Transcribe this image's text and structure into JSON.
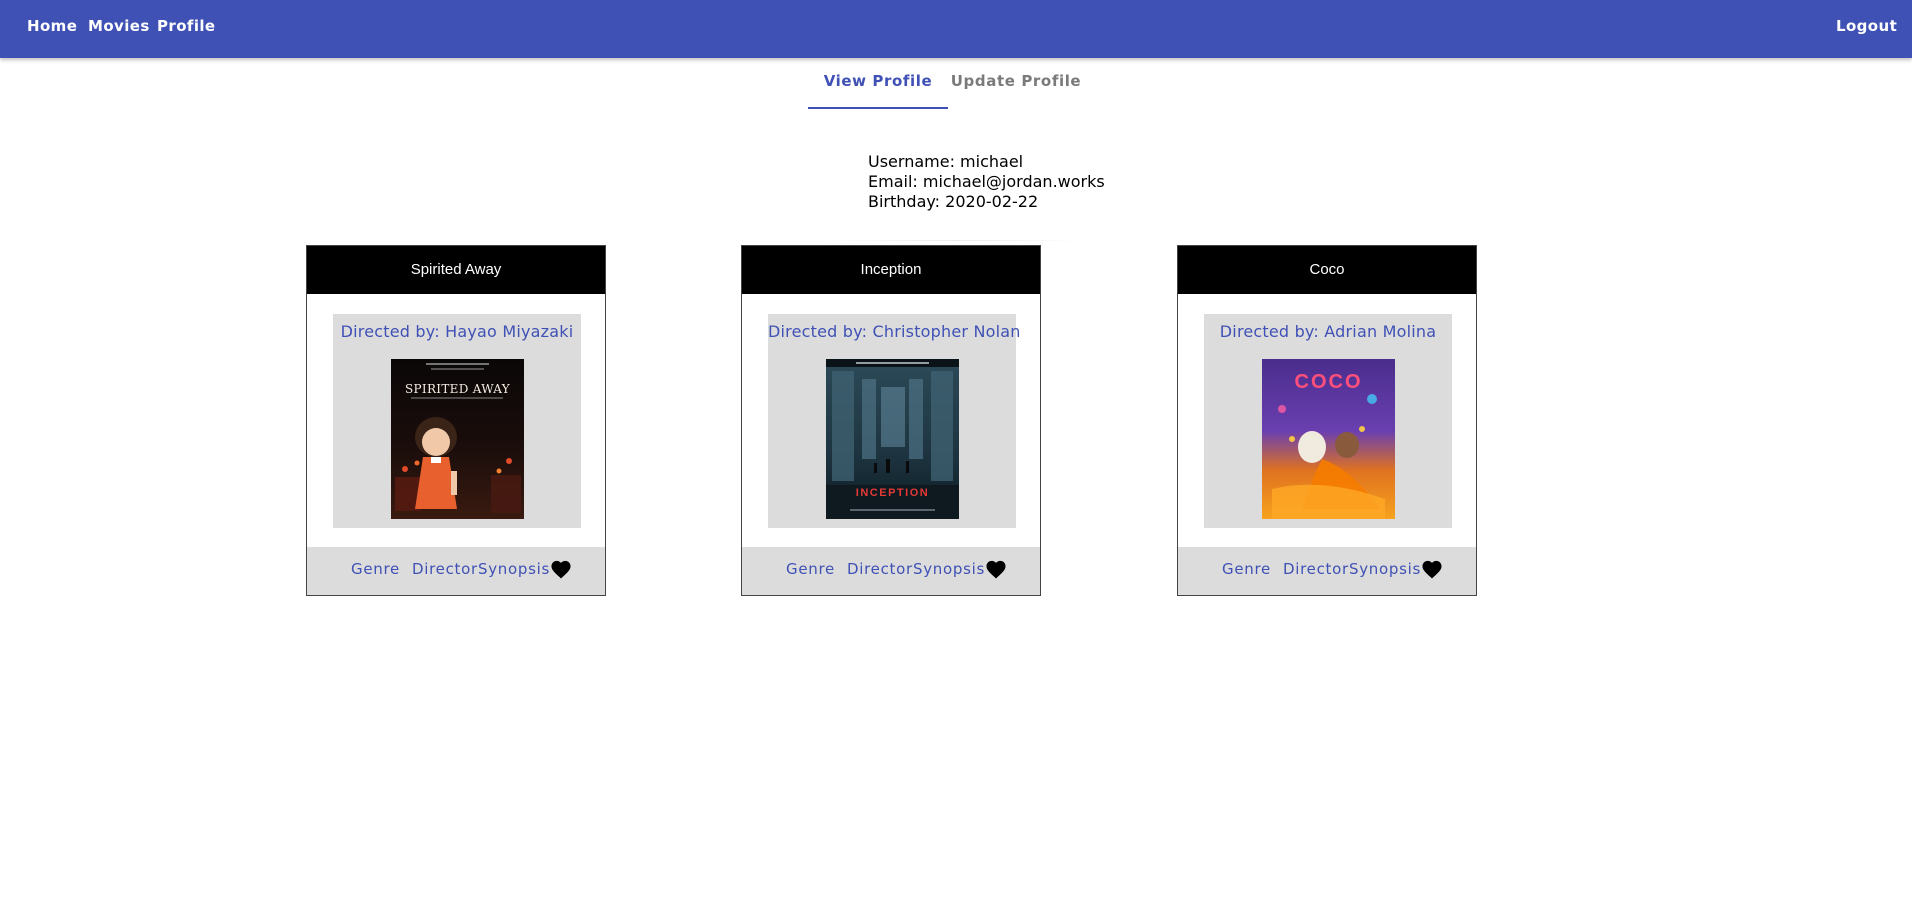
{
  "nav": {
    "home": "Home",
    "movies": "Movies",
    "profile": "Profile",
    "logout": "Logout"
  },
  "tabs": {
    "view": "View Profile",
    "update": "Update Profile"
  },
  "profile": {
    "username": "Username: michael",
    "email": "Email: michael@jordan.works",
    "birthday": "Birthday: 2020-02-22"
  },
  "movies": [
    {
      "title": "Spirited Away",
      "director": "Directed by: Hayao Miyazaki",
      "poster_text": "SPIRITED AWAY",
      "genre_label": "Genre",
      "director_label": "Director",
      "synopsis_label": "Synopsis",
      "favorite_icon": "heart-icon"
    },
    {
      "title": "Inception",
      "director": "Directed by: Christopher Nolan",
      "poster_text": "INCEPTION",
      "genre_label": "Genre",
      "director_label": "Director",
      "synopsis_label": "Synopsis",
      "favorite_icon": "heart-icon"
    },
    {
      "title": "Coco",
      "director": "Directed by: Adrian Molina",
      "poster_text": "COCO",
      "genre_label": "Genre",
      "director_label": "Director",
      "synopsis_label": "Synopsis",
      "favorite_icon": "heart-icon"
    }
  ],
  "colors": {
    "primary": "#3f51b5",
    "card_header": "#000000",
    "card_panel": "#dcdcdc",
    "tab_inactive": "#7a7a7a"
  }
}
